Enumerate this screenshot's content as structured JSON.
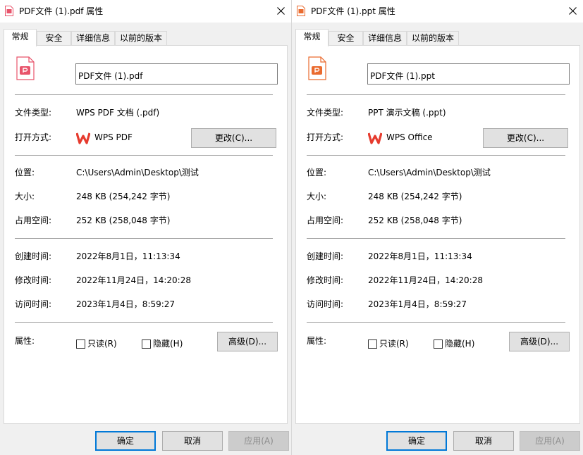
{
  "colors": {
    "pdf_icon": "#e8546b",
    "ppt_icon": "#ea6b2f",
    "wps_logo": "#e63b2e",
    "primary_border": "#0078d7"
  },
  "dialogs": [
    {
      "title": "PDF文件 (1).pdf 属性",
      "title_icon": "pdf-file-icon",
      "tabs": [
        "常规",
        "安全",
        "详细信息",
        "以前的版本"
      ],
      "file_icon": "pdf-file-icon",
      "filename": "PDF文件 (1).pdf",
      "fields": {
        "type_label": "文件类型:",
        "type_value": "WPS PDF 文档 (.pdf)",
        "open_label": "打开方式:",
        "open_app": "WPS PDF",
        "open_app_icon": "wps-logo-icon",
        "change_button": "更改(C)...",
        "location_label": "位置:",
        "location_value": "C:\\Users\\Admin\\Desktop\\测试",
        "size_label": "大小:",
        "size_value": "248 KB (254,242 字节)",
        "disk_label": "占用空间:",
        "disk_value": "252 KB (258,048 字节)",
        "created_label": "创建时间:",
        "created_value": "2022年8月1日，11:13:34",
        "modified_label": "修改时间:",
        "modified_value": "2022年11月24日，14:20:28",
        "accessed_label": "访问时间:",
        "accessed_value": "2023年1月4日，8:59:27",
        "attr_label": "属性:",
        "readonly_label": "只读(R)",
        "hidden_label": "隐藏(H)",
        "advanced_button": "高级(D)..."
      },
      "footer": {
        "ok": "确定",
        "cancel": "取消",
        "apply": "应用(A)"
      }
    },
    {
      "title": "PDF文件 (1).ppt 属性",
      "title_icon": "ppt-file-icon",
      "tabs": [
        "常规",
        "安全",
        "详细信息",
        "以前的版本"
      ],
      "file_icon": "ppt-file-icon",
      "filename": "PDF文件 (1).ppt",
      "fields": {
        "type_label": "文件类型:",
        "type_value": "PPT 演示文稿 (.ppt)",
        "open_label": "打开方式:",
        "open_app": "WPS Office",
        "open_app_icon": "wps-logo-icon",
        "change_button": "更改(C)...",
        "location_label": "位置:",
        "location_value": "C:\\Users\\Admin\\Desktop\\测试",
        "size_label": "大小:",
        "size_value": "248 KB (254,242 字节)",
        "disk_label": "占用空间:",
        "disk_value": "252 KB (258,048 字节)",
        "created_label": "创建时间:",
        "created_value": "2022年8月1日，11:13:34",
        "modified_label": "修改时间:",
        "modified_value": "2022年11月24日，14:20:28",
        "accessed_label": "访问时间:",
        "accessed_value": "2023年1月4日，8:59:27",
        "attr_label": "属性:",
        "readonly_label": "只读(R)",
        "hidden_label": "隐藏(H)",
        "advanced_button": "高级(D)..."
      },
      "footer": {
        "ok": "确定",
        "cancel": "取消",
        "apply": "应用(A)"
      }
    }
  ]
}
